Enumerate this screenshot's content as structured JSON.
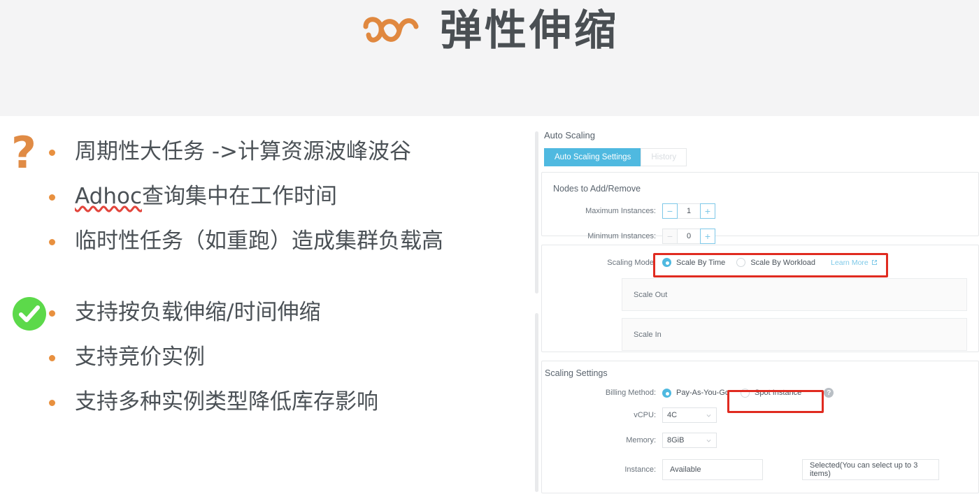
{
  "header": {
    "title": "弹性伸缩",
    "logo_name": "elastic-scaling-logo",
    "logo_color": "#e0883f",
    "background": "#f4f4f5"
  },
  "left": {
    "groups": [
      {
        "icon": "question-mark-icon",
        "icon_glyph": "?",
        "icon_color": "#e08b45",
        "bullets": [
          {
            "text": "周期性大任务 ->计算资源波峰波谷",
            "misspelled_prefix": ""
          },
          {
            "text": "查询集中在工作时间",
            "misspelled_prefix": "Adhoc"
          },
          {
            "text": "临时性任务（如重跑）造成集群负载高",
            "misspelled_prefix": ""
          }
        ]
      },
      {
        "icon": "green-check-icon",
        "icon_color": "#5cd94a",
        "bullets": [
          {
            "text": "支持按负载伸缩/时间伸缩",
            "misspelled_prefix": ""
          },
          {
            "text": "支持竞价实例",
            "misspelled_prefix": ""
          },
          {
            "text": "支持多种实例类型降低库存影响",
            "misspelled_prefix": ""
          }
        ]
      }
    ],
    "bullet_color": "#e8903f",
    "text_color": "#4b5156"
  },
  "app": {
    "section_title": "Auto Scaling",
    "tabs": [
      {
        "label": "Auto Scaling Settings",
        "active": true
      },
      {
        "label": "History",
        "active": false
      }
    ],
    "accent_color": "#4fb9e0",
    "nodes_section": {
      "title": "Nodes to Add/Remove",
      "rows": [
        {
          "label": "Maximum Instances:",
          "value": "1",
          "minus": "−",
          "plus": "+",
          "minus_disabled": false
        },
        {
          "label": "Minimum Instances:",
          "value": "0",
          "minus": "−",
          "plus": "+",
          "minus_disabled": true
        }
      ]
    },
    "scaling_mode": {
      "label": "Scaling Mode:",
      "options": [
        {
          "label": "Scale By Time",
          "selected": true
        },
        {
          "label": "Scale By Workload",
          "selected": false
        }
      ],
      "learn_more": "Learn More",
      "highlighted": true
    },
    "scale_panels": [
      {
        "label": "Scale Out"
      },
      {
        "label": "Scale In"
      }
    ],
    "scaling_settings": {
      "title": "Scaling Settings",
      "billing": {
        "label": "Billing Method:",
        "options": [
          {
            "label": "Pay-As-You-Go",
            "selected": true
          },
          {
            "label": "Spot Instance",
            "selected": false
          }
        ],
        "help": "?",
        "highlighted": true
      },
      "vcpu": {
        "label": "vCPU:",
        "value": "4C"
      },
      "memory": {
        "label": "Memory:",
        "value": "8GiB"
      },
      "instance": {
        "label": "Instance:",
        "available_header": "Available",
        "selected_header": "Selected(You can select up to 3 items)"
      }
    }
  },
  "annotation_color": "#e02b20"
}
